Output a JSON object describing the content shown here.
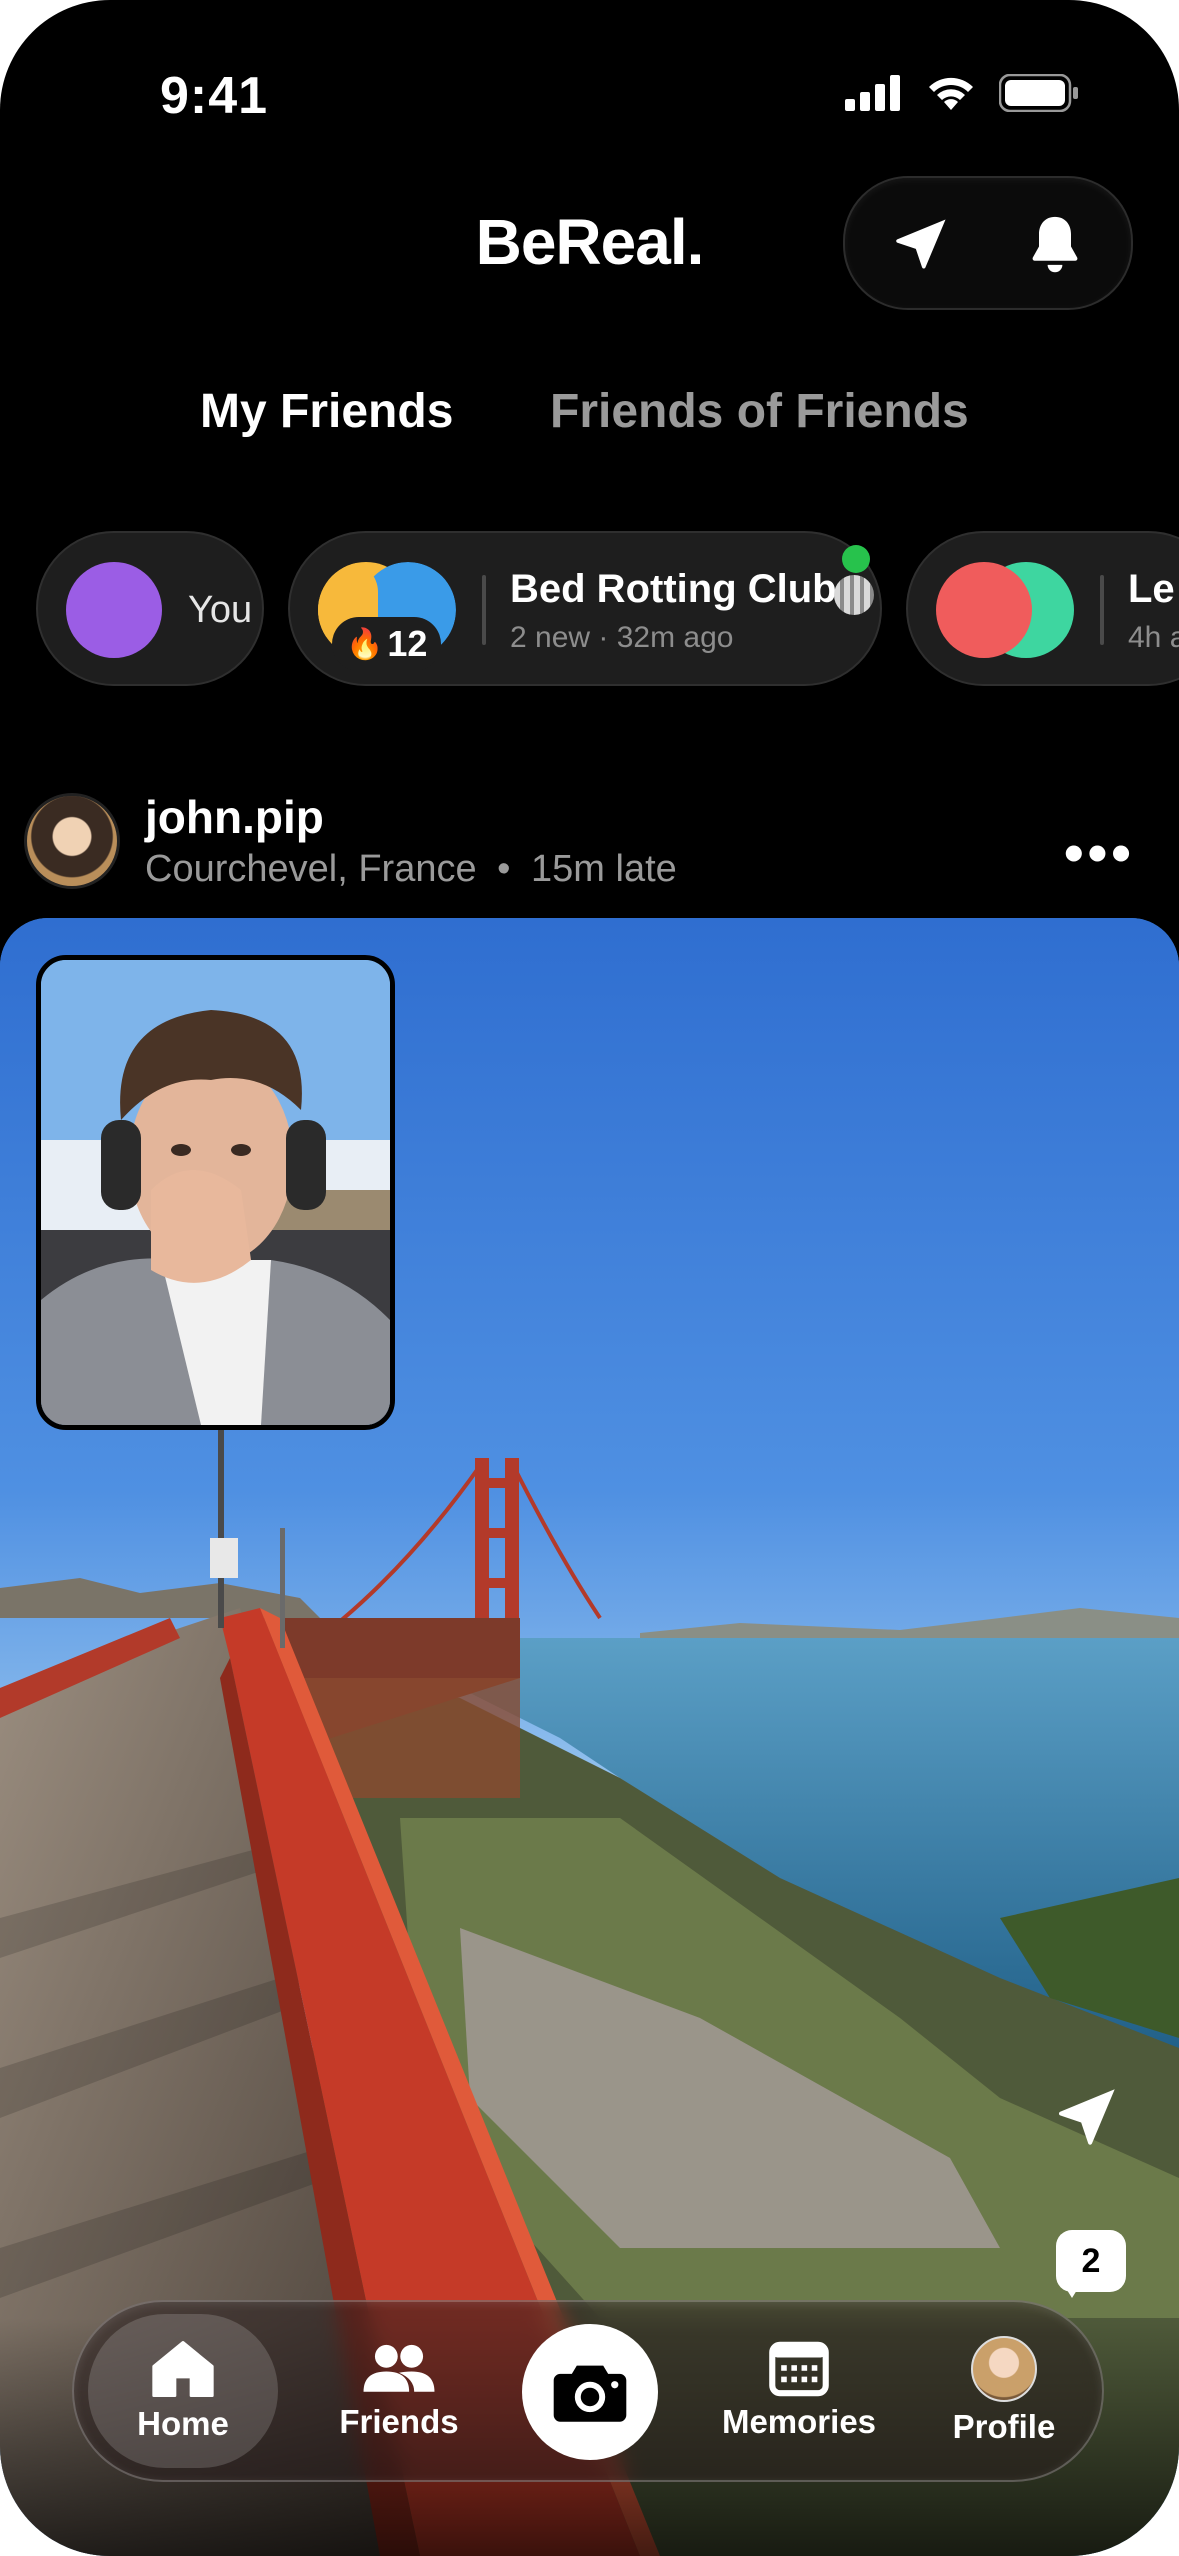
{
  "status_bar": {
    "time": "9:41"
  },
  "header": {
    "logo": "BeReal."
  },
  "tabs": {
    "active": "My Friends",
    "inactive": "Friends of Friends"
  },
  "chips": {
    "you": {
      "label": "You"
    },
    "group": {
      "title": "Bed Rotting Club",
      "subtitle": "2 new · 32m ago",
      "streak": "12",
      "streak_icon": "flame-icon"
    },
    "third": {
      "title": "Le",
      "subtitle": "4h a"
    }
  },
  "post": {
    "username": "john.pip",
    "location": "Courchevel, France",
    "separator": "•",
    "lateness": "15m late",
    "comments_count": "2"
  },
  "nav": {
    "home": "Home",
    "friends": "Friends",
    "memories": "Memories",
    "profile": "Profile"
  },
  "colors": {
    "background": "#000000",
    "accent_purple": "#9b5de5",
    "online": "#27c24c"
  }
}
